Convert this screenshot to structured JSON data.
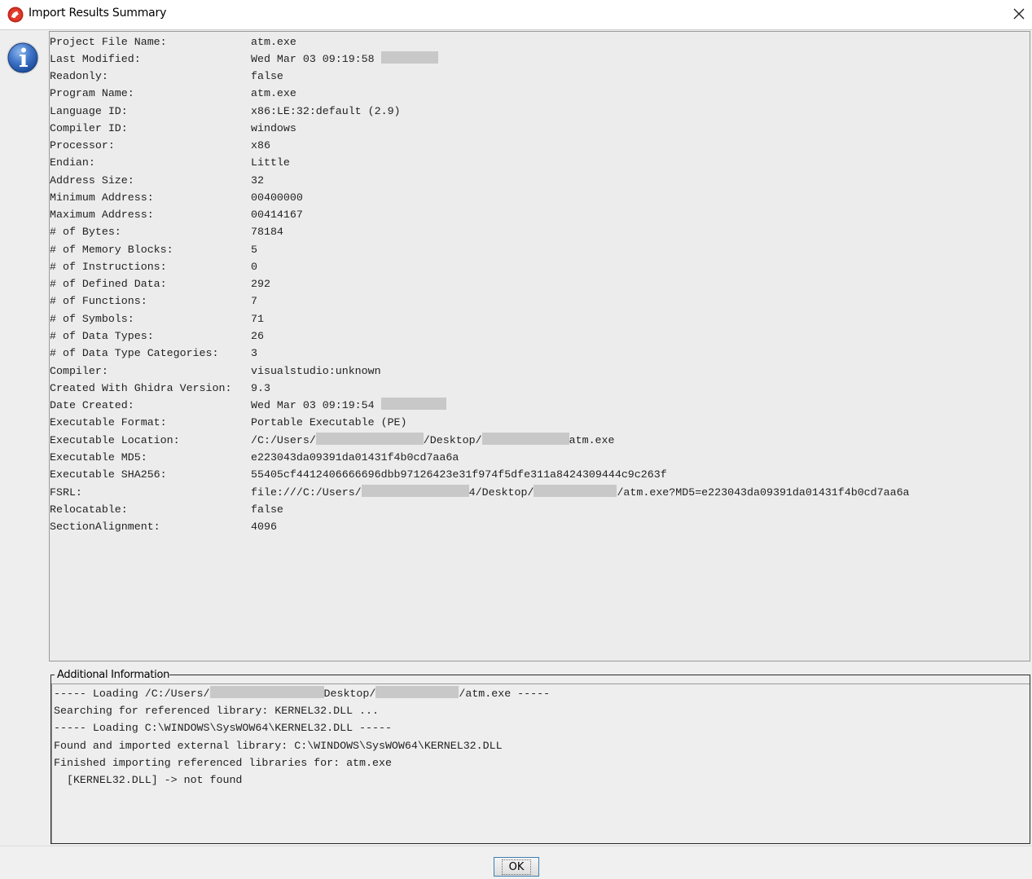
{
  "window": {
    "title": "Import Results Summary",
    "app_icon": "ghidra-dragon-icon",
    "close_icon": "close-icon"
  },
  "info_icon": "information-icon",
  "summary": [
    {
      "label": "Project File Name:",
      "value": "atm.exe"
    },
    {
      "label": "Last Modified:",
      "value": "Wed Mar 03 09:19:58",
      "redacted": true
    },
    {
      "label": "Readonly:",
      "value": "false"
    },
    {
      "label": "Program Name:",
      "value": "atm.exe"
    },
    {
      "label": "Language ID:",
      "value": "x86:LE:32:default (2.9)"
    },
    {
      "label": "Compiler ID:",
      "value": "windows"
    },
    {
      "label": "Processor:",
      "value": "x86"
    },
    {
      "label": "Endian:",
      "value": "Little"
    },
    {
      "label": "Address Size:",
      "value": "32"
    },
    {
      "label": "Minimum Address:",
      "value": "00400000"
    },
    {
      "label": "Maximum Address:",
      "value": "00414167"
    },
    {
      "label": "# of Bytes:",
      "value": "78184"
    },
    {
      "label": "# of Memory Blocks:",
      "value": "5"
    },
    {
      "label": "# of Instructions:",
      "value": "0"
    },
    {
      "label": "# of Defined Data:",
      "value": "292"
    },
    {
      "label": "# of Functions:",
      "value": "7"
    },
    {
      "label": "# of Symbols:",
      "value": "71"
    },
    {
      "label": "# of Data Types:",
      "value": "26"
    },
    {
      "label": "# of Data Type Categories:",
      "value": "3"
    },
    {
      "label": "Compiler:",
      "value": "visualstudio:unknown"
    },
    {
      "label": "Created With Ghidra Version:",
      "value": "9.3"
    },
    {
      "label": "Date Created:",
      "value": "Wed Mar 03 09:19:54",
      "redacted": true
    },
    {
      "label": "Executable Format:",
      "value": "Portable Executable (PE)"
    },
    {
      "label": "Executable Location:",
      "value_parts": [
        "/C:/Users/",
        "/Desktop/",
        "atm.exe"
      ]
    },
    {
      "label": "Executable MD5:",
      "value": "e223043da09391da01431f4b0cd7aa6a"
    },
    {
      "label": "Executable SHA256:",
      "value": "55405cf4412406666696dbb97126423e31f974f5dfe311a8424309444c9c263f"
    },
    {
      "label": "FSRL:",
      "value_parts": [
        "file:///C:/Users/",
        "4/Desktop/",
        "/atm.exe?MD5=e223043da09391da01431f4b0cd7aa6a"
      ]
    },
    {
      "label": "Relocatable:",
      "value": "false"
    },
    {
      "label": "SectionAlignment:",
      "value": "4096"
    }
  ],
  "additional": {
    "title": "Additional Information",
    "line0_parts": [
      "----- Loading /C:/Users/",
      "Desktop/",
      "/atm.exe -----"
    ],
    "lines": [
      "Searching for referenced library: KERNEL32.DLL ...",
      "----- Loading C:\\WINDOWS\\SysWOW64\\KERNEL32.DLL -----",
      "Found and imported external library: C:\\WINDOWS\\SysWOW64\\KERNEL32.DLL",
      "Finished importing referenced libraries for: atm.exe",
      "  [KERNEL32.DLL] -> not found"
    ]
  },
  "buttons": {
    "ok": "OK"
  }
}
